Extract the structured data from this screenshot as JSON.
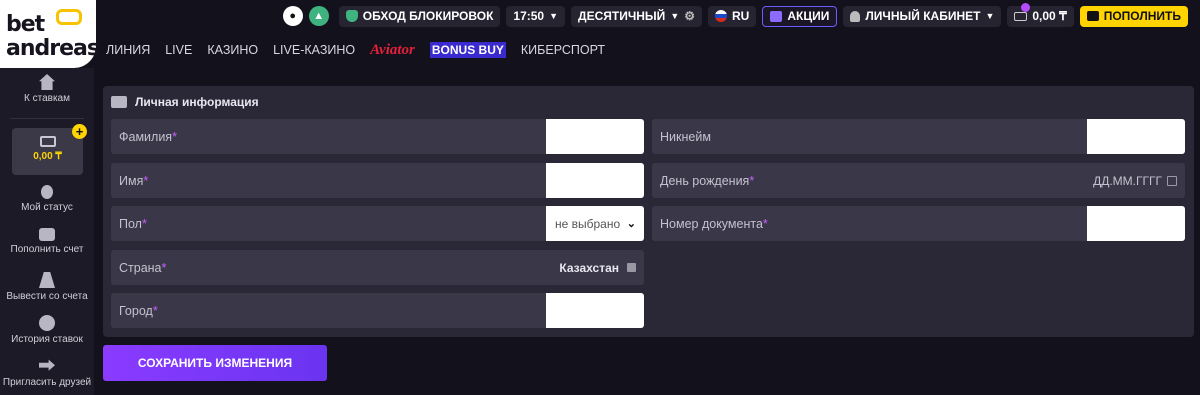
{
  "logo": {
    "line1": "bet",
    "line2": "andreas"
  },
  "topbar": {
    "bypass": "ОБХОД БЛОКИРОВОК",
    "time": "17:50",
    "odds_format": "ДЕСЯТИЧНЫЙ",
    "language": "RU",
    "promos": "АКЦИИ",
    "account": "ЛИЧНЫЙ КАБИНЕТ",
    "balance": "0,00 ₸",
    "deposit": "ПОПОЛНИТЬ"
  },
  "nav": [
    "ЛИНИЯ",
    "LIVE",
    "КАЗИНО",
    "LIVE-КАЗИНО",
    "Aviator",
    "BONUS BUY",
    "КИБЕРСПОРТ"
  ],
  "sidebar": {
    "to_bets": "К ставкам",
    "balance": "0,00 ₸",
    "status": "Мой статус",
    "deposit": "Пополнить счет",
    "withdraw": "Вывести со счета",
    "history": "История ставок",
    "invite": "Пригласить друзей"
  },
  "form": {
    "title": "Личная информация",
    "required_mark": "*",
    "surname": "Фамилия",
    "name": "Имя",
    "gender": "Пол",
    "gender_value": "не выбрано",
    "country": "Страна",
    "country_value": "Казахстан",
    "city": "Город",
    "nickname": "Никнейм",
    "birthday": "День рождения",
    "birthday_placeholder": "ДД.ММ.ГГГГ",
    "document": "Номер документа",
    "save": "СОХРАНИТЬ ИЗМЕНЕНИЯ"
  },
  "colors": {
    "accent": "#8a3bff",
    "yellow": "#ffd400",
    "bg": "#13111c",
    "panel": "#2a2836"
  }
}
